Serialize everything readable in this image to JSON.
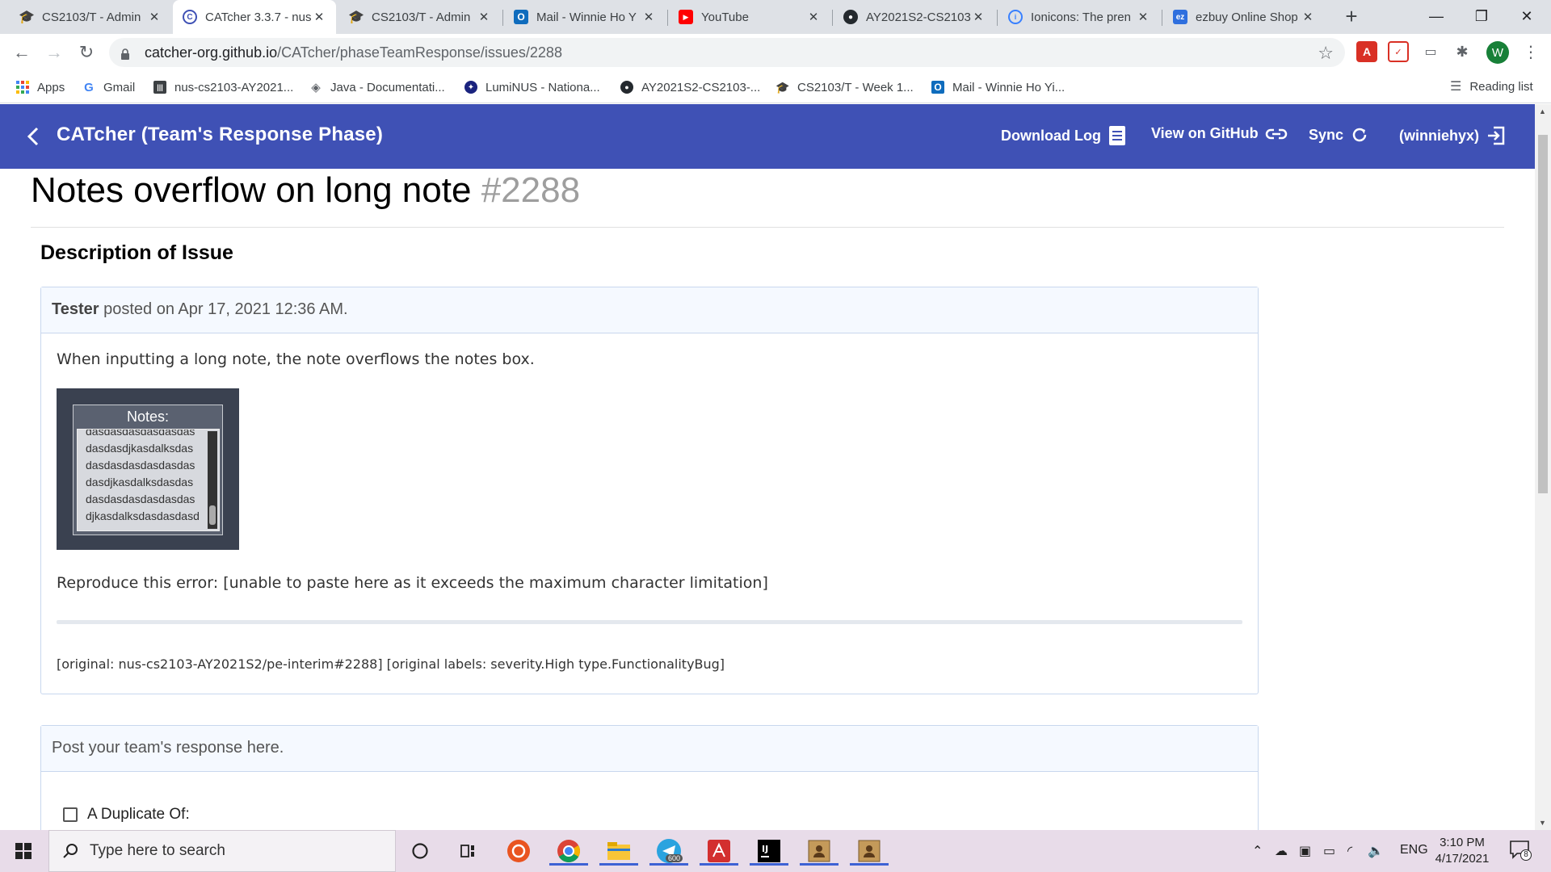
{
  "browser": {
    "tabs": [
      {
        "title": "CS2103/T - Admin",
        "icon": "graduation-cap-icon",
        "active": false
      },
      {
        "title": "CATcher 3.3.7 - nus",
        "icon": "catcher-icon",
        "active": true
      },
      {
        "title": "CS2103/T - Admin",
        "icon": "graduation-cap-icon",
        "active": false
      },
      {
        "title": "Mail - Winnie Ho Y",
        "icon": "outlook-icon",
        "active": false
      },
      {
        "title": "YouTube",
        "icon": "youtube-icon",
        "active": false
      },
      {
        "title": "AY2021S2-CS2103",
        "icon": "github-icon",
        "active": false
      },
      {
        "title": "Ionicons: The pren",
        "icon": "ionicons-icon",
        "active": false
      },
      {
        "title": "ezbuy Online Shop",
        "icon": "ezbuy-icon",
        "active": false
      }
    ],
    "url_host": "catcher-org.github.io",
    "url_path": "/CATcher/phaseTeamResponse/issues/2288",
    "profile_initial": "W",
    "bookmarks": [
      {
        "label": "Apps",
        "icon": "apps-grid-icon"
      },
      {
        "label": "Gmail",
        "icon": "google-icon"
      },
      {
        "label": "nus-cs2103-AY2021...",
        "icon": "nus-icon"
      },
      {
        "label": "Java - Documentati...",
        "icon": "java-icon"
      },
      {
        "label": "LumiNUS - Nationa...",
        "icon": "luminus-icon"
      },
      {
        "label": "AY2021S2-CS2103-...",
        "icon": "github-icon"
      },
      {
        "label": "CS2103/T - Week 1...",
        "icon": "graduation-cap-icon"
      },
      {
        "label": "Mail - Winnie Ho Yi...",
        "icon": "outlook-icon"
      }
    ],
    "reading_list": "Reading list"
  },
  "app": {
    "title": "CATcher  (Team's Response Phase)",
    "download_log": "Download Log",
    "view_github": "View on GitHub",
    "sync": "Sync",
    "user": "(winniehyx)",
    "header_color": "#3f51b5"
  },
  "issue": {
    "title": "Notes overflow on long note",
    "number": "#2288",
    "section_heading": "Description of Issue",
    "author": "Tester",
    "posted_on": "posted on Apr 17, 2021 12:36 AM.",
    "description": "When inputting a long note, the note overflows the notes box.",
    "screenshot": {
      "label": "Notes:",
      "lines": [
        "dasdasdasdasdasdas",
        "dasdasdjkasdalksdas",
        "dasdasdasdasdasdas",
        "dasdjkasdalksdasdas",
        "dasdasdasdasdasdas",
        "djkasdalksdasdasdasd"
      ]
    },
    "reproduce": "Reproduce this error: [unable to paste here as it exceeds the maximum character limitation]",
    "original": "[original: nus-cs2103-AY2021S2/pe-interim#2288] [original labels: severity.High type.FunctionalityBug]"
  },
  "response": {
    "placeholder": "Post your team's response here.",
    "duplicate_label": "A Duplicate Of:"
  },
  "taskbar": {
    "search_placeholder": "Type here to search",
    "telegram_badge": "600",
    "lang": "ENG",
    "time": "3:10 PM",
    "date": "4/17/2021",
    "notifications": "8"
  }
}
